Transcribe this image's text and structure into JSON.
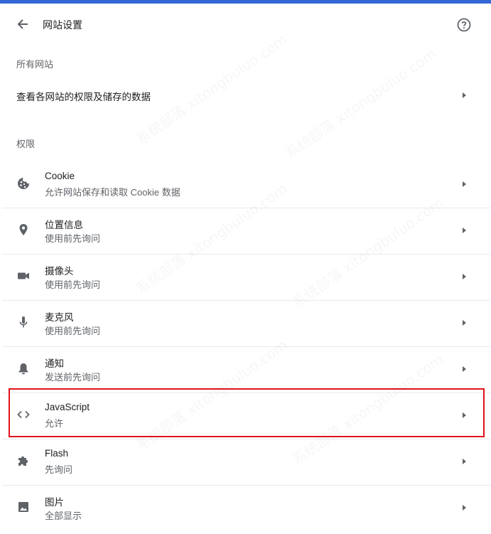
{
  "header": {
    "title": "网站设置",
    "back_icon": "arrow-back-icon",
    "help_icon": "help-circle-icon"
  },
  "all_sites": {
    "section_label": "所有网站",
    "link_label": "查看各网站的权限及储存的数据"
  },
  "permissions": {
    "section_label": "权限",
    "items": [
      {
        "name": "Cookie",
        "sub": "允许网站保存和读取 Cookie 数据",
        "icon": "cookie-icon"
      },
      {
        "name": "位置信息",
        "sub": "使用前先询问",
        "icon": "location-pin-icon"
      },
      {
        "name": "摄像头",
        "sub": "使用前先询问",
        "icon": "camera-icon"
      },
      {
        "name": "麦克风",
        "sub": "使用前先询问",
        "icon": "microphone-icon"
      },
      {
        "name": "通知",
        "sub": "发送前先询问",
        "icon": "bell-icon"
      },
      {
        "name": "JavaScript",
        "sub": "允许",
        "icon": "code-icon"
      },
      {
        "name": "Flash",
        "sub": "先询问",
        "icon": "puzzle-icon"
      },
      {
        "name": "图片",
        "sub": "全部显示",
        "icon": "image-icon"
      }
    ]
  },
  "annotation": {
    "highlighted_item": "JavaScript",
    "color": "#e0121b"
  },
  "watermark": {
    "text": "系统部落 xitongbuluo.com"
  },
  "colors": {
    "accent_bar": "#3367d6",
    "icon": "#5f6368",
    "divider": "#e8eaed"
  }
}
